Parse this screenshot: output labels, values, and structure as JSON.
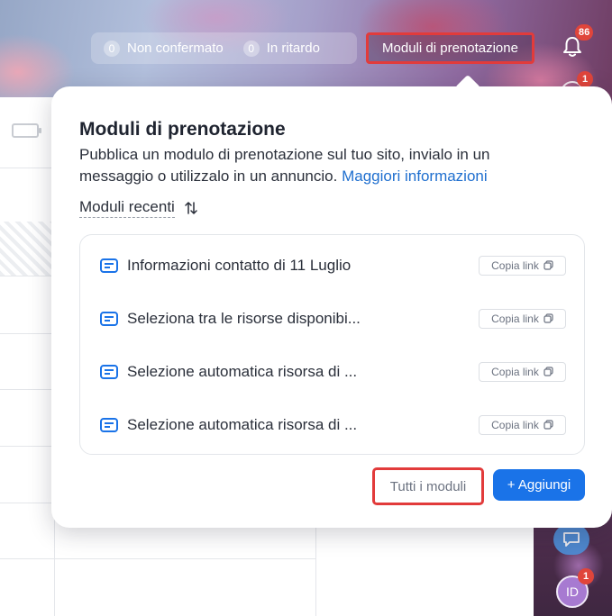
{
  "topbar": {
    "unconfirmed_count": "0",
    "unconfirmed_label": "Non confermato",
    "late_count": "0",
    "late_label": "In ritardo",
    "forms_button_label": "Moduli di prenotazione",
    "notifications_count": "86",
    "secondary_badge_count": "1"
  },
  "popover": {
    "title": "Moduli di prenotazione",
    "description": "Pubblica un modulo di prenotazione sul tuo sito, invialo in un messaggio o utilizzalo in un annuncio.",
    "learn_more_link": "Maggiori informazioni",
    "sort_label": "Moduli recenti",
    "forms": [
      {
        "name": "Informazioni contatto di 11 Luglio",
        "copy_label": "Copia link"
      },
      {
        "name": "Seleziona tra le risorse disponibi...",
        "copy_label": "Copia link"
      },
      {
        "name": "Selezione automatica risorsa di ...",
        "copy_label": "Copia link"
      },
      {
        "name": "Selezione automatica risorsa di ...",
        "copy_label": "Copia link"
      }
    ],
    "all_forms_label": "Tutti i moduli",
    "add_label": "+ Aggiungi"
  },
  "sidebar": {
    "avatar_initials": "ID",
    "avatar_badge": "1"
  },
  "colors": {
    "accent": "#1a73e8",
    "highlight_border": "#e23b3b",
    "badge": "#e0453b",
    "link": "#1f6fcf"
  },
  "icons": [
    "bell-icon",
    "sort-icon",
    "form-icon",
    "copy-icon",
    "chat-icon"
  ]
}
